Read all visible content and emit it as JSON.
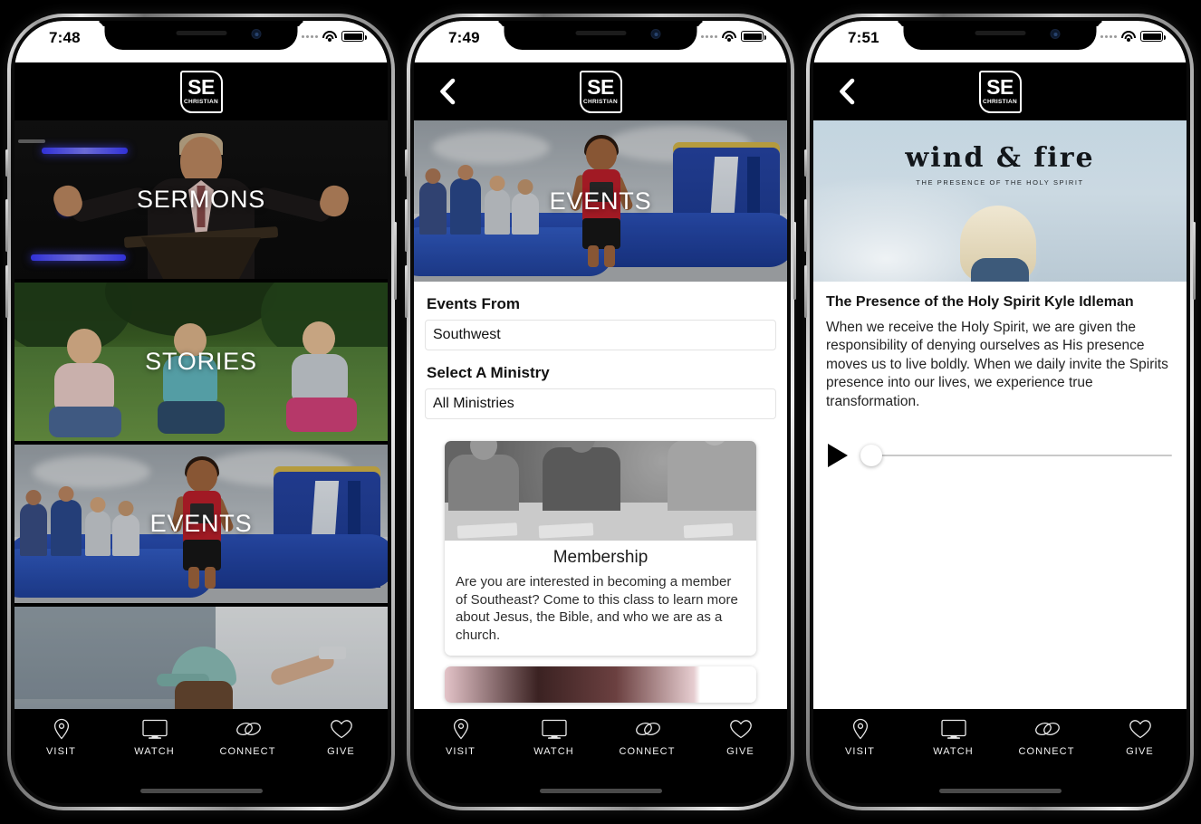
{
  "app": {
    "logo_primary": "SE",
    "logo_secondary": "CHRISTIAN",
    "logo_icon": "se-christian-logo"
  },
  "tabbar": {
    "items": [
      {
        "label": "VISIT",
        "icon": "location-pin-icon"
      },
      {
        "label": "WATCH",
        "icon": "monitor-icon"
      },
      {
        "label": "CONNECT",
        "icon": "linked-rings-icon"
      },
      {
        "label": "GIVE",
        "icon": "heart-icon"
      }
    ]
  },
  "phone1": {
    "status": {
      "time": "7:48",
      "wifi_icon": "wifi-icon",
      "battery_icon": "battery-full-icon",
      "signal_icon": "signal-dots-icon"
    },
    "tiles": [
      {
        "label": "SERMONS",
        "art": "preacher-on-stage"
      },
      {
        "label": "STORIES",
        "art": "three-girls-on-grass"
      },
      {
        "label": "EVENTS",
        "art": "boy-on-inflatable-waterslide"
      },
      {
        "label": "",
        "art": "person-painting-wall"
      }
    ]
  },
  "phone2": {
    "status": {
      "time": "7:49"
    },
    "back_icon": "back-chevron-icon",
    "hero": {
      "label": "EVENTS",
      "art": "boy-on-inflatable-waterslide"
    },
    "filters": [
      {
        "label": "Events From",
        "value": "Southwest",
        "name": "events-from"
      },
      {
        "label": "Select A Ministry",
        "value": "All Ministries",
        "name": "select-a-ministry"
      }
    ],
    "events": [
      {
        "title": "Membership",
        "description": "Are you are interested in becoming a member of Southeast?  Come to this class to learn more about Jesus, the Bible, and who we are as a church.",
        "art": "men-studying-bible"
      }
    ]
  },
  "phone3": {
    "status": {
      "time": "7:51"
    },
    "back_icon": "back-chevron-icon",
    "hero": {
      "title": "wind & fire",
      "subtitle": "THE PRESENCE OF THE HOLY SPIRIT",
      "art": "woman-facing-sky"
    },
    "detail": {
      "title": "The Presence of the Holy Spirit Kyle Idleman",
      "description": "When we receive the Holy Spirit, we are given the responsibility of denying ourselves as His presence moves us to live boldly. When we daily invite the Spirits presence into our lives, we experience true transformation."
    },
    "player": {
      "play_icon": "play-triangle-icon",
      "progress_percent": 0
    }
  },
  "colors": {
    "background": "#000000",
    "panel": "#ffffff",
    "text_dark": "#141414",
    "tab_label": "#f2f2f2"
  }
}
